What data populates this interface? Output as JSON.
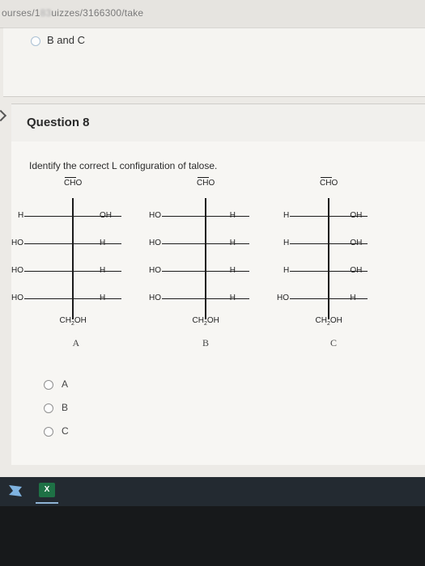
{
  "browser": {
    "url_visible_start": "ourses/1",
    "url_blurred": "83",
    "url_visible_end": "uizzes/3166300/take"
  },
  "previous_question": {
    "option_label": "B and C"
  },
  "question": {
    "title": "Question 8",
    "prompt": "Identify the correct L configuration of talose.",
    "structures": [
      {
        "letter": "A",
        "top": "CHO",
        "bottom": "CH2OH",
        "rows": [
          {
            "left": "H",
            "right": "OH"
          },
          {
            "left": "HO",
            "right": "H"
          },
          {
            "left": "HO",
            "right": "H"
          },
          {
            "left": "HO",
            "right": "H"
          }
        ]
      },
      {
        "letter": "B",
        "top": "CHO",
        "bottom": "CH2OH",
        "rows": [
          {
            "left": "HO",
            "right": "H"
          },
          {
            "left": "HO",
            "right": "H"
          },
          {
            "left": "HO",
            "right": "H"
          },
          {
            "left": "HO",
            "right": "H"
          }
        ]
      },
      {
        "letter": "C",
        "top": "CHO",
        "bottom": "CH2OH",
        "rows": [
          {
            "left": "H",
            "right": "OH"
          },
          {
            "left": "H",
            "right": "OH"
          },
          {
            "left": "H",
            "right": "OH"
          },
          {
            "left": "HO",
            "right": "H"
          }
        ]
      }
    ],
    "options": [
      "A",
      "B",
      "C"
    ]
  },
  "taskbar": {
    "items": [
      {
        "name": "start-icon",
        "color": "#7fb3e0"
      },
      {
        "name": "excel-icon",
        "label": "X",
        "color": "#1e7145"
      }
    ]
  }
}
